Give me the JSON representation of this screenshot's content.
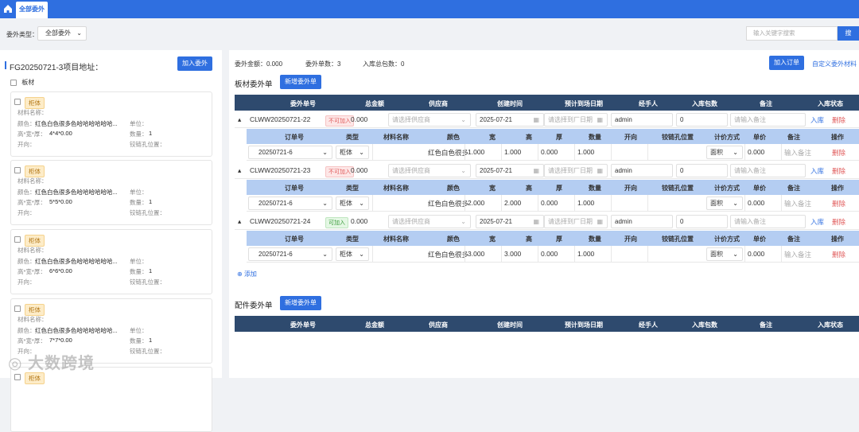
{
  "nav": {
    "tab": "全部委外"
  },
  "filter": {
    "label": "委外类型：",
    "value": "全部委外",
    "search_placeholder": "输入关键字搜索",
    "search_btn": "搜"
  },
  "left": {
    "title": "FG20250721-3项目地址：",
    "add_btn": "加入委外",
    "board": "板材",
    "cards": [
      {
        "tag": "柜体",
        "mat": "材料名称：",
        "color_lbl": "颜色：",
        "color": "红色白色很多色哈哈哈哈哈哈...",
        "unit": "单位：",
        "dims_lbl": "高*宽*厚：",
        "dims": "4*4*0.00",
        "qty_lbl": "数量：",
        "qty": "1",
        "dir": "开向：",
        "hinge": "铰链孔位置："
      },
      {
        "tag": "柜体",
        "mat": "材料名称：",
        "color_lbl": "颜色：",
        "color": "红色白色很多色哈哈哈哈哈哈...",
        "unit": "单位：",
        "dims_lbl": "高*宽*厚：",
        "dims": "5*5*0.00",
        "qty_lbl": "数量：",
        "qty": "1",
        "dir": "开向：",
        "hinge": "铰链孔位置："
      },
      {
        "tag": "柜体",
        "mat": "材料名称：",
        "color_lbl": "颜色：",
        "color": "红色白色很多色哈哈哈哈哈哈...",
        "unit": "单位：",
        "dims_lbl": "高*宽*厚：",
        "dims": "6*6*0.00",
        "qty_lbl": "数量：",
        "qty": "1",
        "dir": "开向：",
        "hinge": "铰链孔位置："
      },
      {
        "tag": "柜体",
        "mat": "材料名称：",
        "color_lbl": "颜色：",
        "color": "红色白色很多色哈哈哈哈哈哈...",
        "unit": "单位：",
        "dims_lbl": "高*宽*厚：",
        "dims": "7*7*0.00",
        "qty_lbl": "数量：",
        "qty": "1",
        "dir": "开向：",
        "hinge": "铰链孔位置："
      },
      {
        "tag": "柜体"
      }
    ]
  },
  "stats": {
    "amount": "委外金额：0.000",
    "count": "委外单数：3",
    "packages": "入库总包数：0"
  },
  "actions": {
    "add_order": "加入订单",
    "custom": "自定义委外材料"
  },
  "board_section": {
    "title": "板材委外单",
    "new_btn": "新增委外单"
  },
  "headers": [
    "委外单号",
    "总金额",
    "供应商",
    "创建时间",
    "预计到场日期",
    "经手人",
    "入库包数",
    "备注",
    "入库状态"
  ],
  "sub_headers": [
    "订单号",
    "类型",
    "材料名称",
    "颜色",
    "宽",
    "高",
    "厚",
    "数量",
    "开向",
    "铰链孔位置",
    "计价方式",
    "单价",
    "备注",
    "操作"
  ],
  "orders": [
    {
      "no": "CLWW20250721-22",
      "badge": "不可加入",
      "badge_type": "red",
      "amount": "0.000",
      "supplier": "请选择供应商",
      "date": "2025-07-21",
      "eta": "请选择到厂日期",
      "handler": "admin",
      "packages": "0",
      "note": "请输入备注",
      "in": "入库",
      "del": "删除",
      "row": {
        "order": "20250721-6",
        "type": "柜体",
        "color": "红色白色很多",
        "w": "1.000",
        "h": "1.000",
        "t": "0.000",
        "qty": "1.000",
        "price_mode": "面积",
        "price": "0.000",
        "note": "输入备注",
        "op": "删除"
      }
    },
    {
      "no": "CLWW20250721-23",
      "badge": "不可加入",
      "badge_type": "red",
      "amount": "0.000",
      "supplier": "请选择供应商",
      "date": "2025-07-21",
      "eta": "请选择到厂日期",
      "handler": "admin",
      "packages": "0",
      "note": "请输入备注",
      "in": "入库",
      "del": "删除",
      "row": {
        "order": "20250721-6",
        "type": "柜体",
        "color": "红色白色很多",
        "w": "2.000",
        "h": "2.000",
        "t": "0.000",
        "qty": "1.000",
        "price_mode": "面积",
        "price": "0.000",
        "note": "输入备注",
        "op": "删除"
      }
    },
    {
      "no": "CLWW20250721-24",
      "badge": "可加入",
      "badge_type": "green",
      "amount": "0.000",
      "supplier": "请选择供应商",
      "date": "2025-07-21",
      "eta": "请选择到厂日期",
      "handler": "admin",
      "packages": "0",
      "note": "请输入备注",
      "in": "入库",
      "del": "删除",
      "row": {
        "order": "20250721-6",
        "type": "柜体",
        "color": "红色白色很多",
        "w": "3.000",
        "h": "3.000",
        "t": "0.000",
        "qty": "1.000",
        "price_mode": "面积",
        "price": "0.000",
        "note": "输入备注",
        "op": "删除"
      }
    }
  ],
  "add_link": "添加",
  "parts_section": {
    "title": "配件委外单",
    "new_btn": "新增委外单"
  },
  "watermark": "大数跨境"
}
